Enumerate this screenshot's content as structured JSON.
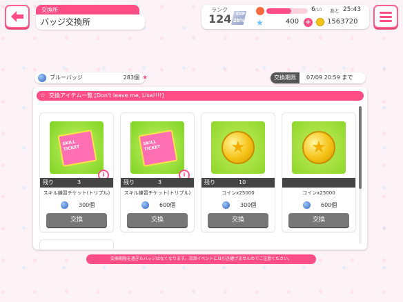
{
  "header": {
    "category": "交換所",
    "title": "バッジ交換所"
  },
  "status": {
    "rank_label": "ランク",
    "rank": "124",
    "exp_label": "EXP",
    "exp_percent": "28%",
    "lp_fill_fraction": 0.6,
    "lp_current": "6",
    "lp_max": "/10",
    "lp_next_label": "あと",
    "lp_next_time": "25:43",
    "stars": "400",
    "coins": "1563720"
  },
  "badge": {
    "name": "ブルーバッジ",
    "count": "283個"
  },
  "period": {
    "label": "交換期限",
    "value": "07/09 20:59 まで"
  },
  "panel": {
    "heading": "交換アイテム一覧 [Don't leave me, Lisa!!!!]"
  },
  "items": [
    {
      "stock_label": "残り",
      "stock": "3",
      "name": "スキル練習チケット(トリプル)",
      "cost": "300個",
      "button": "交換",
      "ticket_text": "SKILL TICKET"
    },
    {
      "stock_label": "残り",
      "stock": "3",
      "name": "スキル練習チケット(トリプル)",
      "cost": "600個",
      "button": "交換",
      "ticket_text": "SKILL TICKET"
    },
    {
      "stock_label": "残り",
      "stock": "10",
      "name": "コインx25000",
      "cost": "300個",
      "button": "交換"
    },
    {
      "stock_label": "",
      "stock": "",
      "name": "コインx25000",
      "cost": "600個",
      "button": "交換"
    }
  ],
  "footer": {
    "note": "交換期限を過ぎたバッジはなくなります。次回イベントには引き継げませんのでご注意ください。"
  },
  "icons": {
    "back": "back-arrow-icon",
    "menu": "menu-icon",
    "lp": "flame-icon",
    "star": "star-icon",
    "coin": "coin-icon",
    "badge": "blue-badge-icon"
  },
  "colors": {
    "accent": "#ff4d86",
    "button": "#777777"
  }
}
